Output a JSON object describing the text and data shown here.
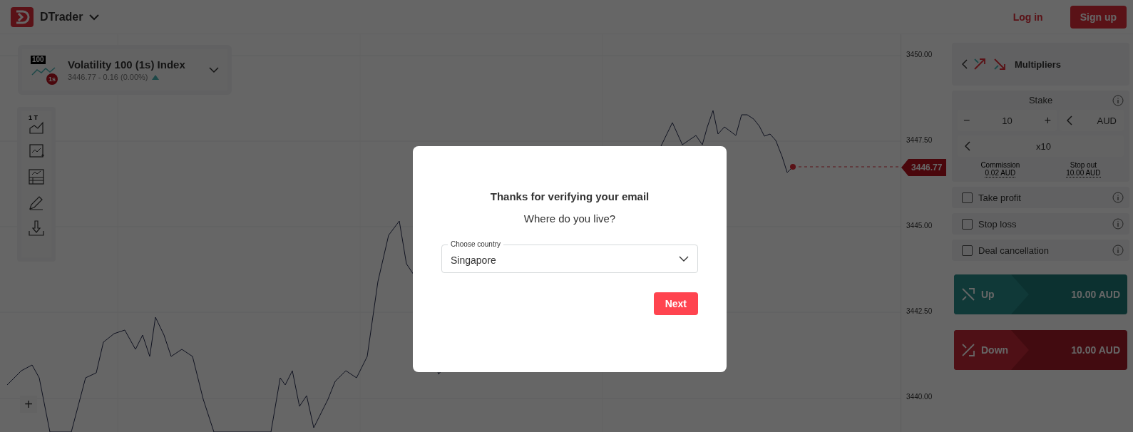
{
  "header": {
    "app_name": "DTrader",
    "login": "Log in",
    "signup": "Sign up"
  },
  "symbol": {
    "badge": "100",
    "sub_badge": "1s",
    "name": "Volatility 100 (1s) Index",
    "quote": "3446.77 - 0.16 (0.00%)",
    "rising": true
  },
  "toolbar": {
    "interval": "1 T"
  },
  "zoom_in": "+",
  "price_axis": [
    "3450.00",
    "3447.50",
    "3445.00",
    "3442.50",
    "3440.00"
  ],
  "current_price": "3446.77",
  "trade": {
    "type": "Multipliers",
    "stake_label": "Stake",
    "stake_minus": "−",
    "stake": "10",
    "stake_plus": "+",
    "currency": "AUD",
    "multiplier": "x10",
    "commission_label": "Commission",
    "commission": "0.02 AUD",
    "stop_out_label": "Stop out",
    "stop_out": "10.00 AUD",
    "options": [
      {
        "label": "Take profit",
        "checked": false
      },
      {
        "label": "Stop loss",
        "checked": false
      },
      {
        "label": "Deal cancellation",
        "checked": false
      }
    ],
    "buttons": [
      {
        "kind": "up",
        "label": "Up",
        "amount": "10.00 AUD"
      },
      {
        "kind": "down",
        "label": "Down",
        "amount": "10.00 AUD"
      }
    ]
  },
  "dialog": {
    "title": "Thanks for verifying your email",
    "question": "Where do you live?",
    "field_label": "Choose country",
    "value": "Singapore",
    "button": "Next"
  }
}
